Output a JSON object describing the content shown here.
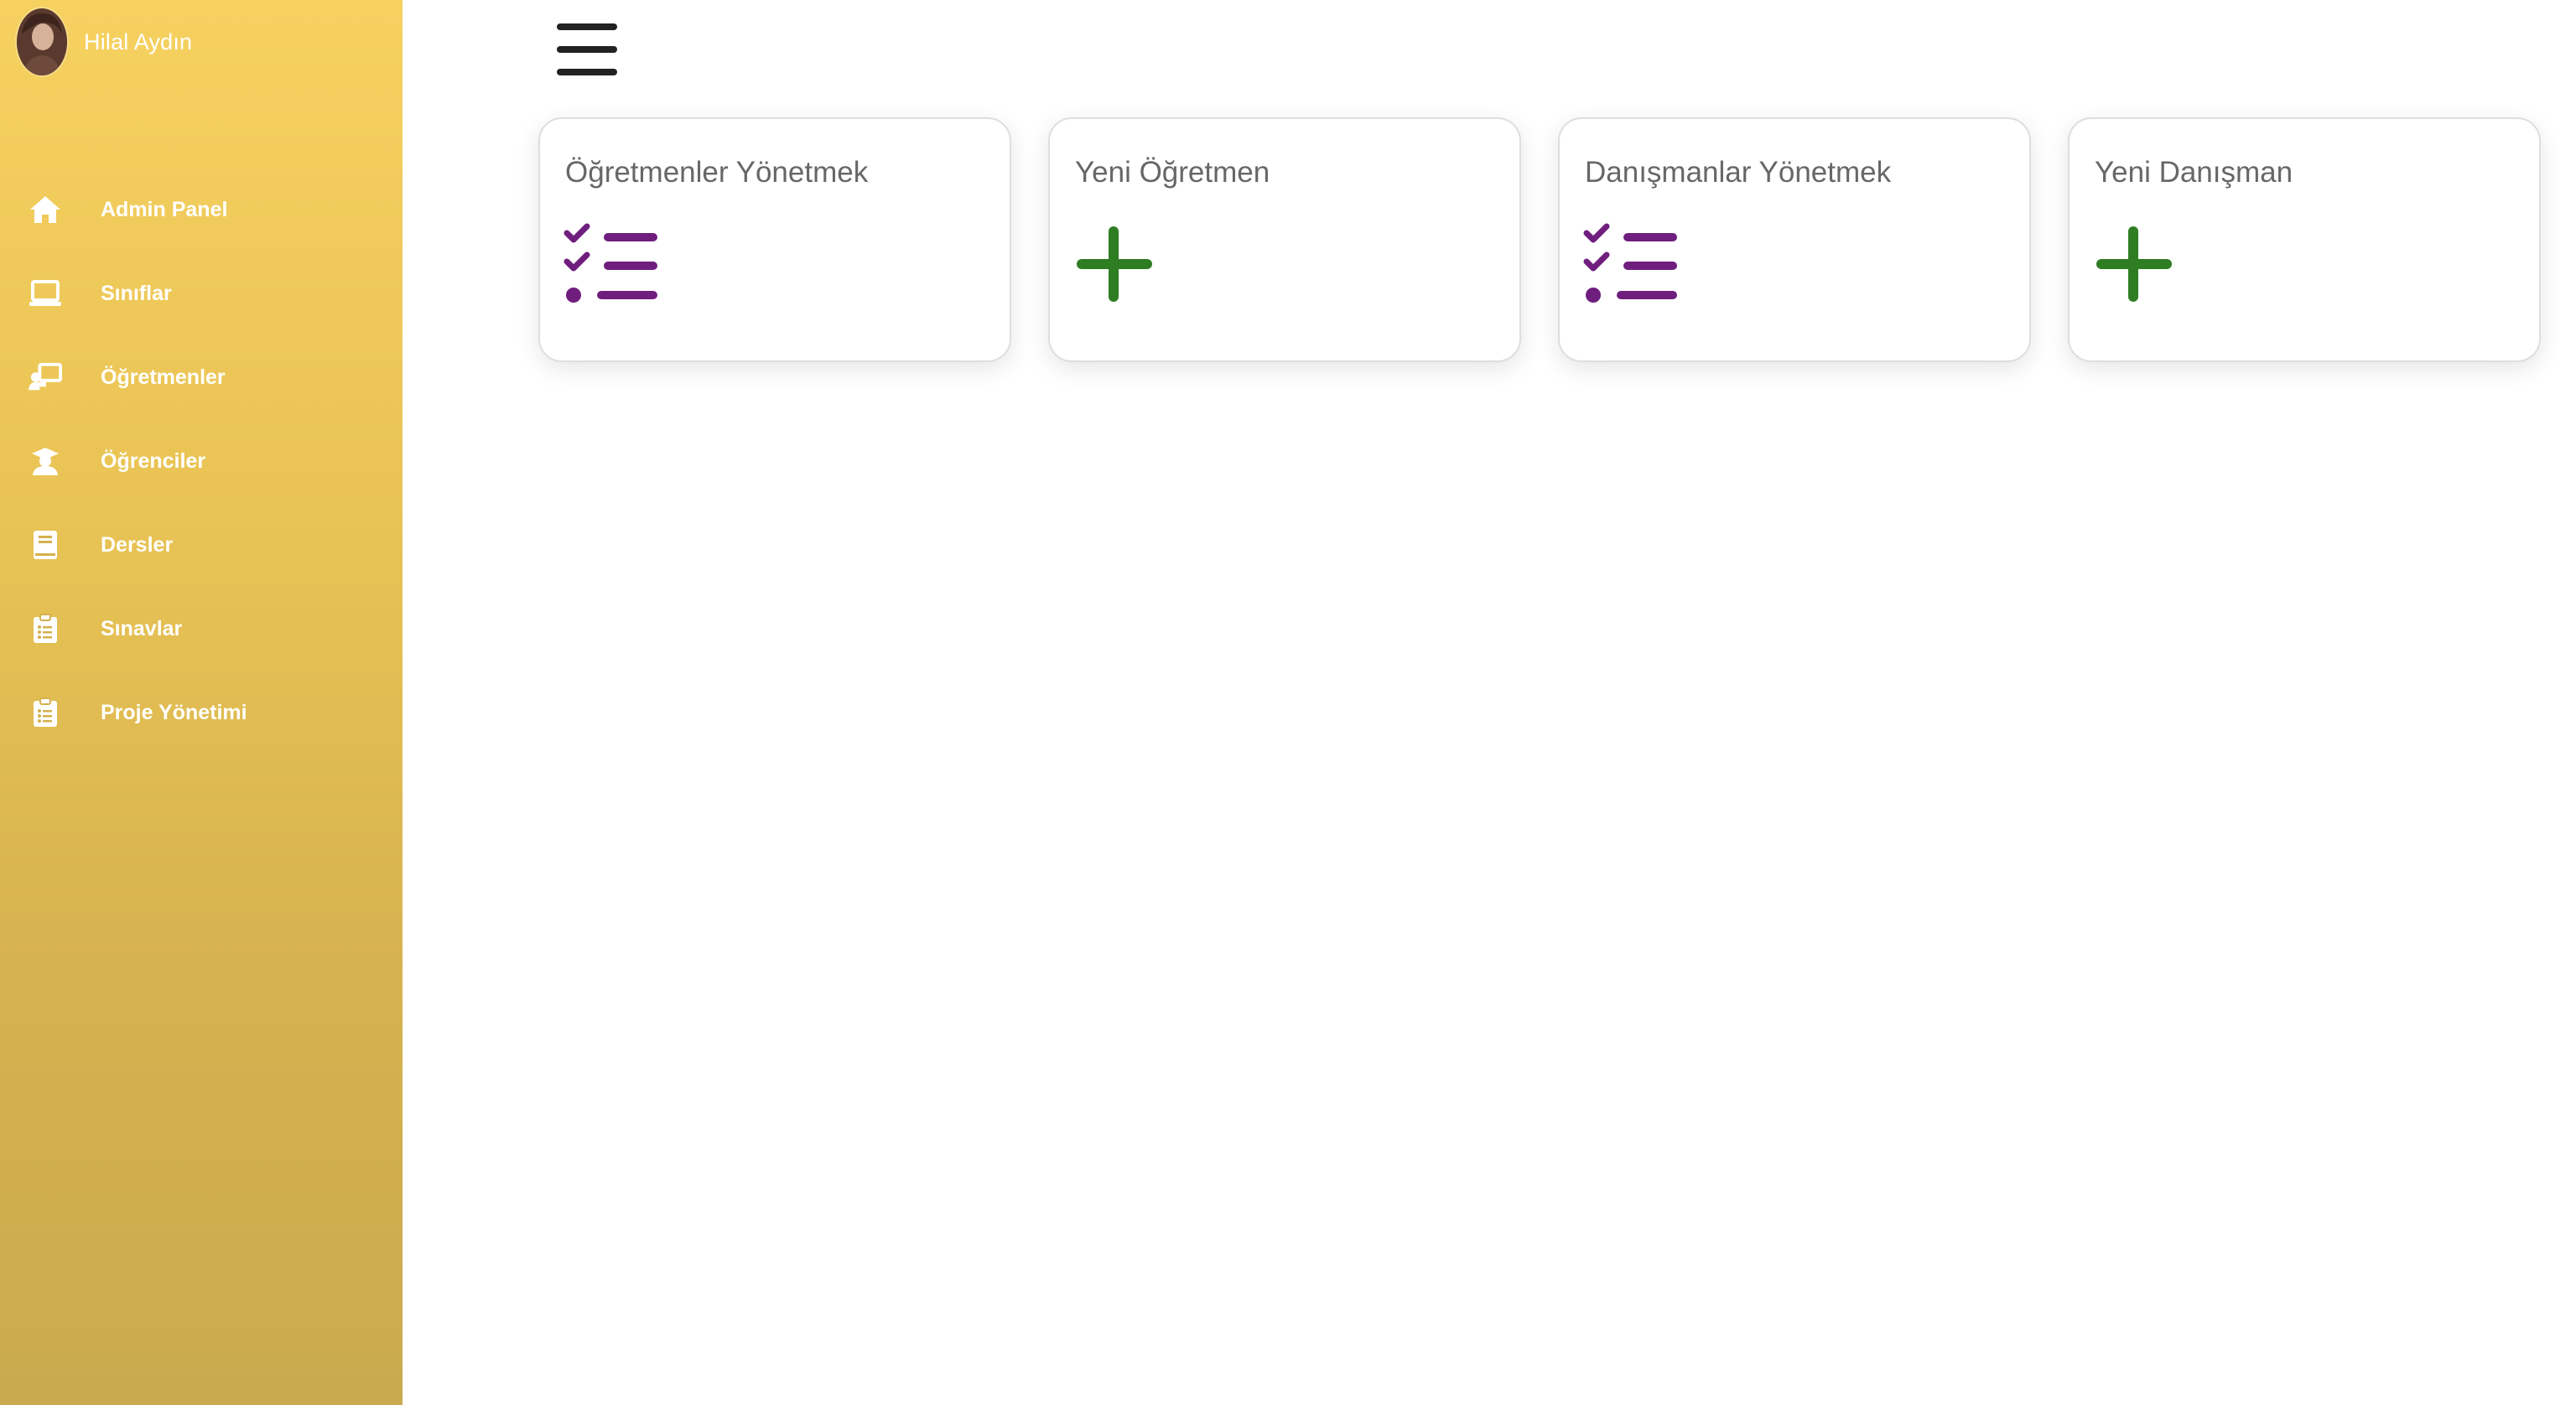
{
  "user": {
    "name": "Hilal Aydın"
  },
  "sidebar": {
    "items": [
      {
        "label": "Admin Panel",
        "icon": "home-icon"
      },
      {
        "label": "Sınıflar",
        "icon": "laptop-icon"
      },
      {
        "label": "Öğretmenler",
        "icon": "teacher-board-icon"
      },
      {
        "label": "Öğrenciler",
        "icon": "student-graduate-icon"
      },
      {
        "label": "Dersler",
        "icon": "book-icon"
      },
      {
        "label": "Sınavlar",
        "icon": "clipboard-list-icon"
      },
      {
        "label": "Proje Yönetimi",
        "icon": "clipboard-list-icon"
      }
    ]
  },
  "header": {
    "menu_icon": "hamburger-menu-icon"
  },
  "cards": [
    {
      "title": "Öğretmenler Yönetmek",
      "icon": "checklist-icon",
      "icon_color": "#6f1e7e"
    },
    {
      "title": "Yeni Öğretmen",
      "icon": "plus-icon",
      "icon_color": "#2e7d22"
    },
    {
      "title": "Danışmanlar Yönetmek",
      "icon": "checklist-icon",
      "icon_color": "#6f1e7e"
    },
    {
      "title": "Yeni Danışman",
      "icon": "plus-icon",
      "icon_color": "#2e7d22"
    }
  ],
  "colors": {
    "sidebar_top": "#f6d160",
    "sidebar_bottom": "#c9aa4e",
    "sidebar_text": "#ffffff",
    "card_border": "#dedede",
    "card_title": "#676767"
  }
}
